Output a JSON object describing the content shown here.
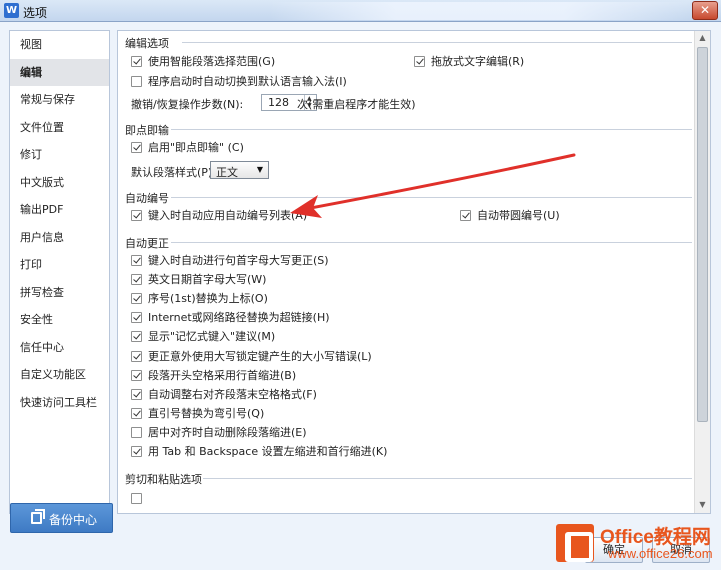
{
  "window": {
    "title": "选项",
    "app_icon": "W",
    "close_glyph": "✕"
  },
  "sidebar": {
    "items": [
      {
        "label": "视图"
      },
      {
        "label": "编辑",
        "active": true
      },
      {
        "label": "常规与保存"
      },
      {
        "label": "文件位置"
      },
      {
        "label": "修订"
      },
      {
        "label": "中文版式"
      },
      {
        "label": "输出PDF"
      },
      {
        "label": "用户信息"
      },
      {
        "label": "打印"
      },
      {
        "label": "拼写检查"
      },
      {
        "label": "安全性"
      },
      {
        "label": "信任中心"
      },
      {
        "label": "自定义功能区"
      },
      {
        "label": "快速访问工具栏"
      }
    ],
    "backup_label": "备份中心"
  },
  "sections": {
    "edit": {
      "title": "编辑选项",
      "smart_select": "使用智能段落选择范围(G)",
      "drag_text": "拖放式文字编辑(R)",
      "auto_ime": "程序启动时自动切换到默认语言输入法(I)",
      "undo_label": "撤销/恢复操作步数(N):",
      "undo_value": "128",
      "undo_note": "次(需重启程序才能生效)"
    },
    "click_type": {
      "title": "即点即输",
      "enable": "启用\"即点即输\" (C)",
      "default_style_label": "默认段落样式(P):",
      "default_style_value": "正文"
    },
    "auto_number": {
      "title": "自动编号",
      "apply_list": "键入时自动应用自动编号列表(A)",
      "circle_number": "自动带圆编号(U)"
    },
    "auto_correct": {
      "title": "自动更正",
      "items": [
        {
          "label": "键入时自动进行句首字母大写更正(S)",
          "checked": true
        },
        {
          "label": "英文日期首字母大写(W)",
          "checked": true
        },
        {
          "label": "序号(1st)替换为上标(O)",
          "checked": true
        },
        {
          "label": "Internet或网络路径替换为超链接(H)",
          "checked": true
        },
        {
          "label": "显示\"记忆式键入\"建议(M)",
          "checked": true
        },
        {
          "label": "更正意外使用大写锁定键产生的大小写错误(L)",
          "checked": true
        },
        {
          "label": "段落开头空格采用行首缩进(B)",
          "checked": true
        },
        {
          "label": "自动调整右对齐段落末空格格式(F)",
          "checked": true
        },
        {
          "label": "直引号替换为弯引号(Q)",
          "checked": true
        },
        {
          "label": "居中对齐时自动删除段落缩进(E)",
          "checked": false
        },
        {
          "label": "用 Tab 和 Backspace 设置左缩进和首行缩进(K)",
          "checked": true
        }
      ]
    },
    "paste": {
      "title": "剪切和粘贴选项"
    }
  },
  "buttons": {
    "ok": "确定",
    "cancel": "取消"
  },
  "watermark": {
    "line1": "Office教程网",
    "line2": "www.office26.com"
  },
  "colors": {
    "accent": "#3e7ac4",
    "arrow": "#e0302a",
    "watermark": "#e8561e"
  }
}
